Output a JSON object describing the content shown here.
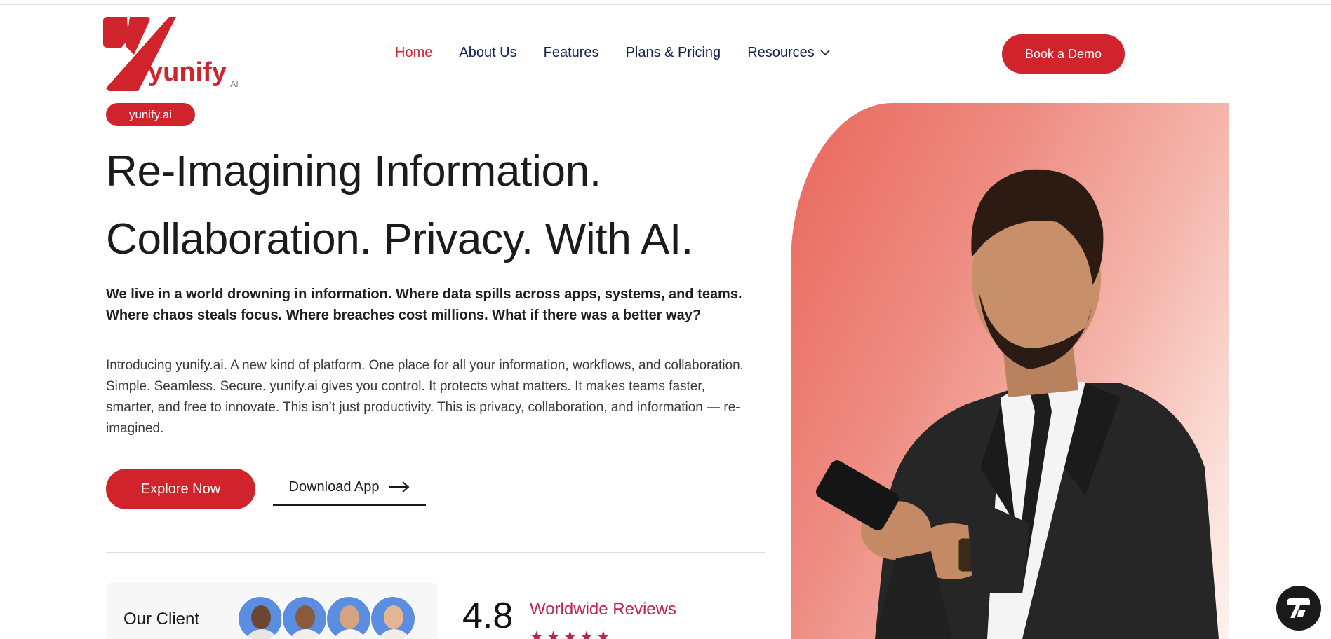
{
  "brand": {
    "logo_text": "yunify",
    "logo_suffix": ".AI",
    "accent_color": "#d1232c"
  },
  "nav": {
    "items": [
      {
        "label": "Home",
        "active": true
      },
      {
        "label": "About Us",
        "active": false
      },
      {
        "label": "Features",
        "active": false
      },
      {
        "label": "Plans & Pricing",
        "active": false
      },
      {
        "label": "Resources",
        "active": false,
        "has_dropdown": true
      }
    ],
    "cta_label": "Book a Demo"
  },
  "hero": {
    "badge": "yunify.ai",
    "headline_line1": "Re-Imagining Information.",
    "headline_line2": "Collaboration. Privacy. With AI.",
    "lead": "We live in a world drowning in information. Where data spills across apps, systems, and teams. Where chaos steals focus. Where breaches cost millions. What if there was a better way?",
    "body": "Introducing yunify.ai. A new kind of platform. One place for all your information, workflows, and collaboration. Simple. Seamless. Secure. yunify.ai gives you control. It protects what matters. It makes teams faster, smarter, and free to innovate. This isn’t just productivity. This is privacy, collaboration, and information — re-imagined.",
    "primary_button": "Explore Now",
    "secondary_button": "Download App"
  },
  "social_proof": {
    "clients_label": "Our Client",
    "avatar_count": 4,
    "rating": "4.8",
    "reviews_label": "Worldwide Reviews",
    "stars": 5
  },
  "icons": {
    "resources_dropdown": "chevron-down-icon",
    "download_arrow": "arrow-right-icon",
    "chat_widget": "chat-widget-icon"
  }
}
